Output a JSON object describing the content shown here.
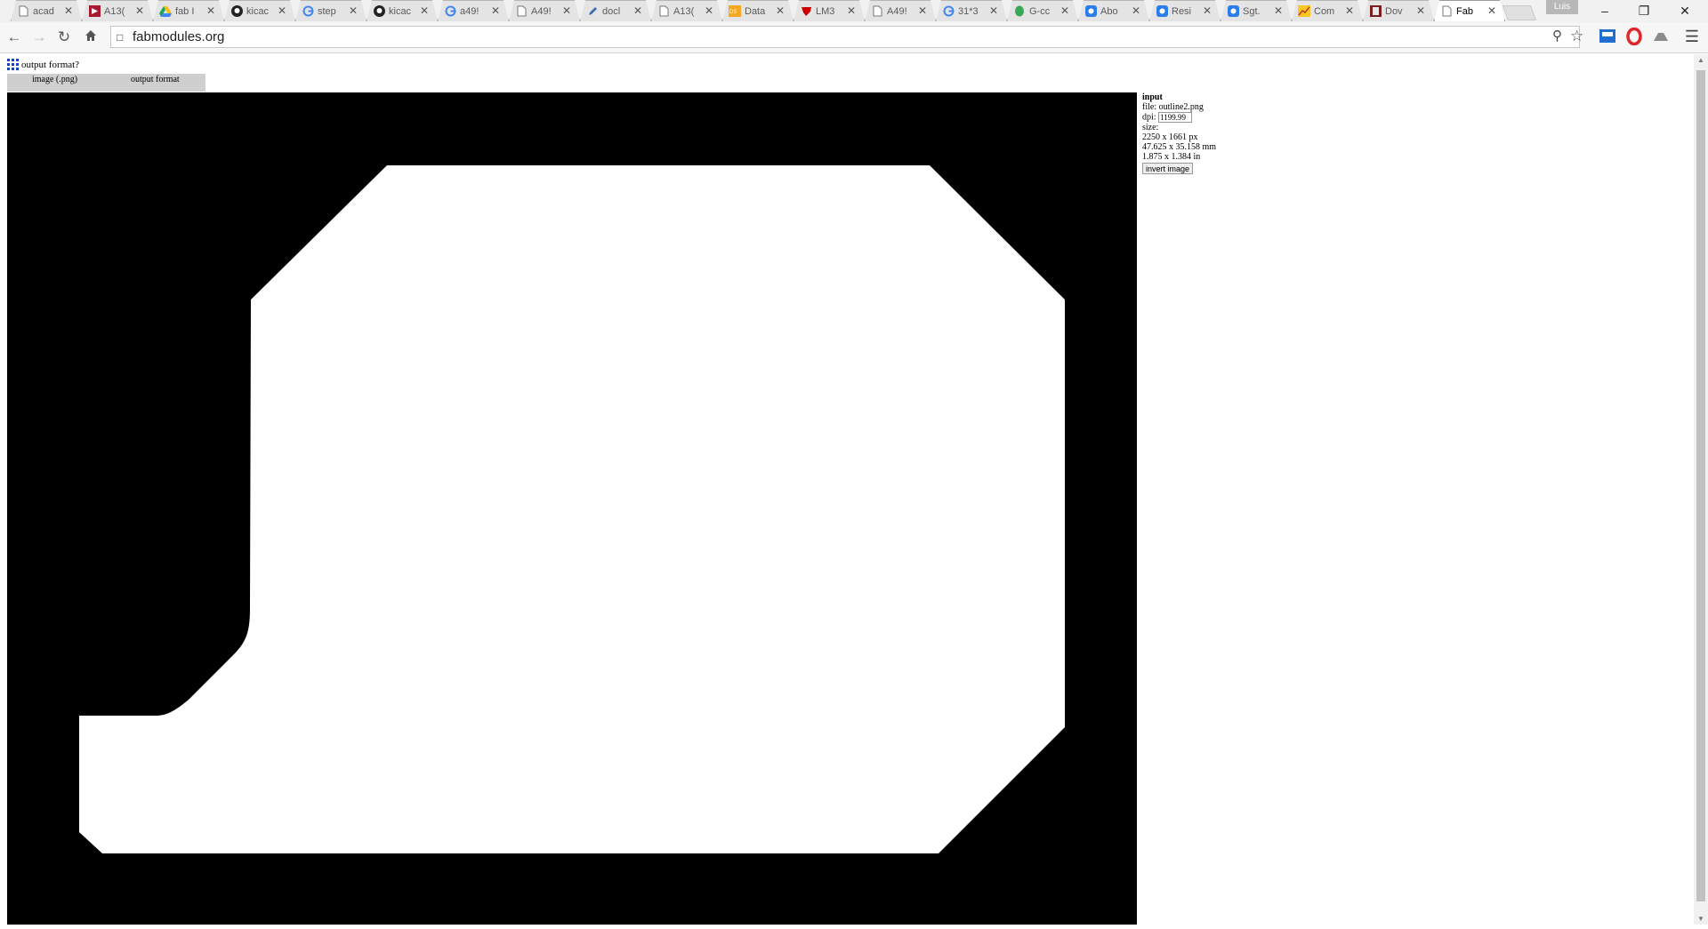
{
  "tabs": [
    {
      "title": "acad",
      "icon": "page-icon",
      "active": false
    },
    {
      "title": "A13(",
      "icon": "altium-icon",
      "active": false
    },
    {
      "title": "fab I",
      "icon": "drive-icon",
      "active": false
    },
    {
      "title": "kicac",
      "icon": "github-icon",
      "active": false
    },
    {
      "title": "step",
      "icon": "google-icon",
      "active": false
    },
    {
      "title": "kicac",
      "icon": "github-icon",
      "active": false
    },
    {
      "title": "a49!",
      "icon": "google-icon",
      "active": false
    },
    {
      "title": "A49!",
      "icon": "page-icon",
      "active": false
    },
    {
      "title": "docl",
      "icon": "pen-icon",
      "active": false
    },
    {
      "title": "A13(",
      "icon": "page-icon",
      "active": false
    },
    {
      "title": "Data",
      "icon": "datasheet-icon",
      "active": false
    },
    {
      "title": "LM3",
      "icon": "ti-icon",
      "active": false
    },
    {
      "title": "A49!",
      "icon": "page-icon",
      "active": false
    },
    {
      "title": "31*3",
      "icon": "google-icon",
      "active": false
    },
    {
      "title": "G-cc",
      "icon": "leaf-icon",
      "active": false
    },
    {
      "title": "Abo",
      "icon": "blue-square-icon",
      "active": false
    },
    {
      "title": "Resi",
      "icon": "blue-square-icon",
      "active": false
    },
    {
      "title": "Sgt.",
      "icon": "blue-square-icon",
      "active": false
    },
    {
      "title": "Com",
      "icon": "chart-icon",
      "active": false
    },
    {
      "title": "Dov",
      "icon": "book-icon",
      "active": false
    },
    {
      "title": "Fab",
      "icon": "page-icon",
      "active": true
    }
  ],
  "profile_name": "Luis",
  "address": {
    "url": "fabmodules.org"
  },
  "page": {
    "title": "output format?",
    "format_tabs": [
      "image (.png)",
      "output format"
    ]
  },
  "info": {
    "heading": "input",
    "file_line": "file: outline2.png",
    "dpi_label": "dpi:",
    "dpi_value": "1199.99",
    "size_label": "size:",
    "size_px": "2250 x 1661 px",
    "size_mm": "47.625 x 35.158 mm",
    "size_in": "1.875 x 1.384 in",
    "invert_button": "invert image"
  },
  "colors": {
    "link_blue": "#1a3fbf",
    "canvas_bg": "#000000",
    "shape_fill": "#ffffff"
  }
}
